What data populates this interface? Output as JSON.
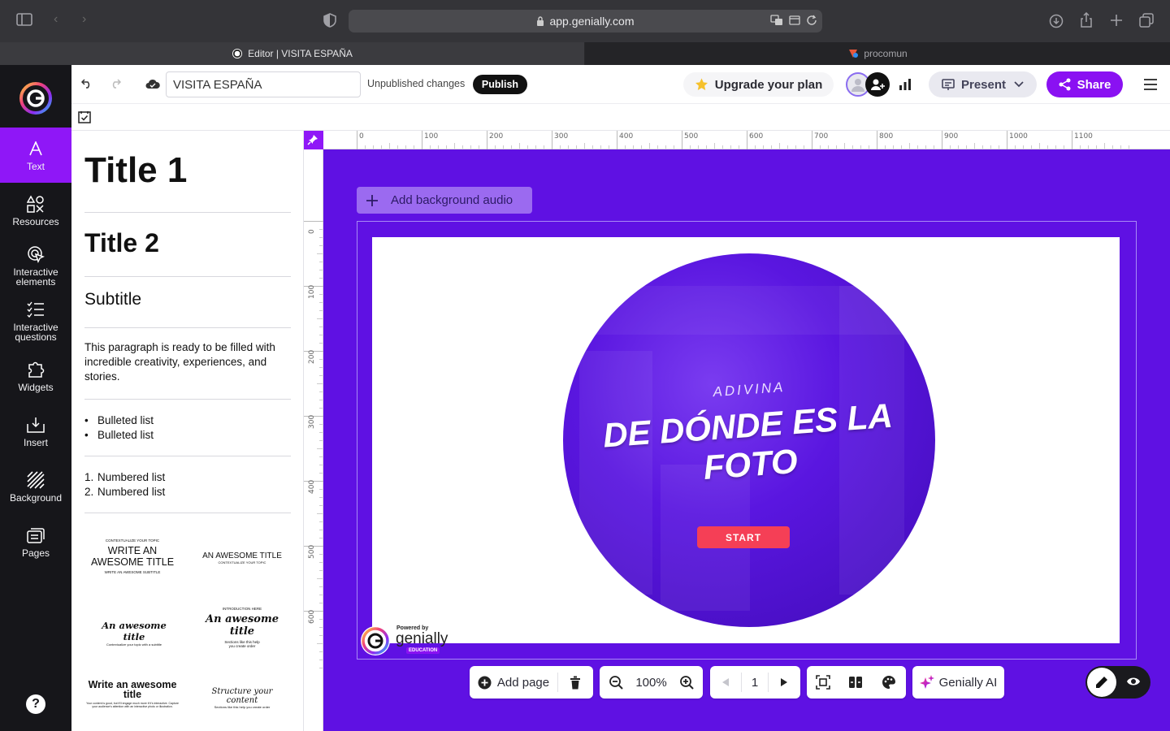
{
  "browser": {
    "url": "app.genially.com",
    "tabs": [
      {
        "label": "Editor | VISITA ESPAÑA",
        "active": true
      },
      {
        "label": "procomun",
        "active": false
      }
    ]
  },
  "rail": {
    "items": [
      {
        "label": "Text",
        "icon": "text-icon",
        "active": true
      },
      {
        "label": "Resources",
        "icon": "resources-icon"
      },
      {
        "label": "Interactive elements",
        "icon": "interactive-elements-icon"
      },
      {
        "label": "Interactive questions",
        "icon": "questions-icon"
      },
      {
        "label": "Widgets",
        "icon": "widgets-icon"
      },
      {
        "label": "Insert",
        "icon": "insert-icon"
      },
      {
        "label": "Background",
        "icon": "background-icon"
      },
      {
        "label": "Pages",
        "icon": "pages-icon"
      }
    ],
    "help_label": "?"
  },
  "topbar": {
    "project_title": "VISITA ESPAÑA",
    "status": "Unpublished changes",
    "publish_label": "Publish",
    "upgrade_label": "Upgrade your plan",
    "present_label": "Present",
    "share_label": "Share"
  },
  "text_panel": {
    "title1": "Title 1",
    "title2": "Title 2",
    "subtitle": "Subtitle",
    "paragraph": "This paragraph is ready to be filled with incredible creativity, experiences, and stories.",
    "bullets": [
      "Bulleted list",
      "Bulleted list"
    ],
    "numbers": [
      "Numbered list",
      "Numbered list"
    ],
    "templates": {
      "t1_kicker": "CONTEXTUALIZE YOUR TOPIC",
      "t1_title": "WRITE AN AWESOME TITLE",
      "t1_sub": "WRITE AN AWESOME SUBTITLE",
      "t2_title": "AN AWESOME TITLE",
      "t2_sub": "CONTEXTUALIZE YOUR TOPIC",
      "t3_title": "An awesome title",
      "t3_sub": "Contextualize your topic with a subtitle",
      "t4_kicker": "INTRODUCTION HERE",
      "t4_title": "An awesome title",
      "t4_sub": "Sections like this help you create order",
      "t5_title": "Write an awesome title",
      "t5_sub": "Your content is good, but it'll engage much more if it's interactive. Capture your audience's attention with an interactive photo or illustration.",
      "t6_title": "Structure your content",
      "t6_sub": "Sections like this help you create order"
    }
  },
  "rulers": {
    "top": [
      "0",
      "100",
      "200",
      "300",
      "400",
      "500",
      "600",
      "700",
      "800",
      "900",
      "1000",
      "1100"
    ],
    "left": [
      "0",
      "100",
      "200",
      "300",
      "400",
      "500",
      "600"
    ]
  },
  "stage": {
    "bg_audio_label": "Add background audio",
    "slide": {
      "kicker": "ADIVINA",
      "title": "DE DÓNDE ES LA FOTO",
      "start_label": "START"
    },
    "powered_by": "Powered by",
    "brand": "genially",
    "edition": "EDUCATION"
  },
  "bottom_toolbar": {
    "add_page_label": "Add page",
    "zoom": "100%",
    "page_number": "1",
    "ai_label": "Genially AI"
  },
  "colors": {
    "accent": "#8a11f2",
    "stage_bg": "#5f11e3",
    "start_button": "#f53f56",
    "rail_bg": "#16161a"
  }
}
